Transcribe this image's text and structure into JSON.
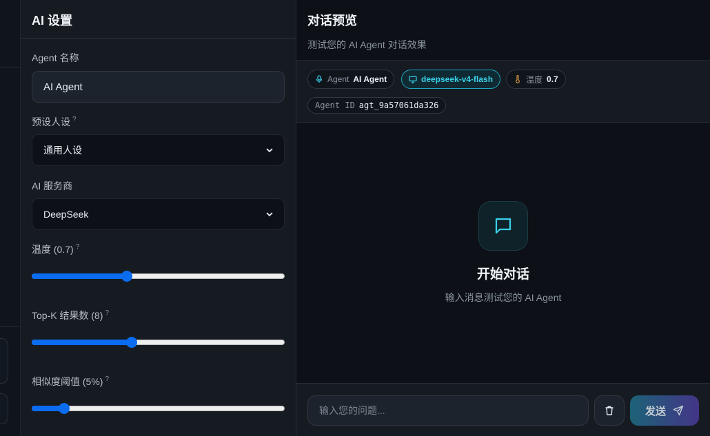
{
  "settings": {
    "title": "AI 设置",
    "agent_name_label": "Agent 名称",
    "agent_name_value": "AI Agent",
    "persona_label": "预设人设",
    "persona_help": "?",
    "persona_value": "通用人设",
    "provider_label": "AI 服务商",
    "provider_value": "DeepSeek",
    "temperature_label": "温度 (0.7)",
    "temperature_help": "?",
    "temperature_fraction": 0.37,
    "topk_label": "Top-K 结果数 (8)",
    "topk_help": "?",
    "topk_fraction": 0.389,
    "similarity_label": "相似度阈值 (5%)",
    "similarity_help": "?",
    "similarity_fraction": 0.11,
    "slider_color": "#0b6cf0"
  },
  "chat": {
    "title": "对话预览",
    "subtitle": "测试您的 AI Agent 对话效果",
    "meta": {
      "agent_key": "Agent",
      "agent_value": "AI Agent",
      "model_value": "deepseek-v4-flash",
      "temp_key": "温度",
      "temp_value": "0.7",
      "id_key": "Agent ID",
      "id_value": "agt_9a57061da326"
    },
    "empty_title": "开始对话",
    "empty_subtitle": "输入消息测试您的 AI Agent",
    "input_placeholder": "输入您的问题...",
    "send_label": "发送",
    "accent_color": "#3ad0e8"
  }
}
